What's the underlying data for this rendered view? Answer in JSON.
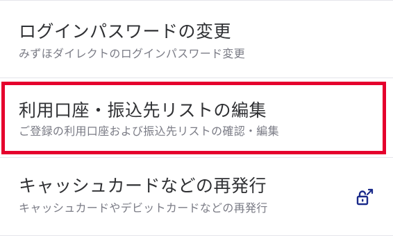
{
  "menu": {
    "items": [
      {
        "title": "ログインパスワードの変更",
        "subtitle": "みずほダイレクトのログインパスワード変更"
      },
      {
        "title": "利用口座・振込先リストの編集",
        "subtitle": "ご登録の利用口座および振込先リストの確認・編集"
      },
      {
        "title": "キャッシュカードなどの再発行",
        "subtitle": "キャッシュカードやデビットカードなどの再発行"
      }
    ]
  },
  "colors": {
    "title_text": "#2f3033",
    "subtitle_text": "#7a7b85",
    "highlight_border": "#e5002d",
    "icon": "#1a2a8a",
    "divider": "#e4e4ea"
  },
  "icons": {
    "external_link": "lock-external-icon"
  }
}
